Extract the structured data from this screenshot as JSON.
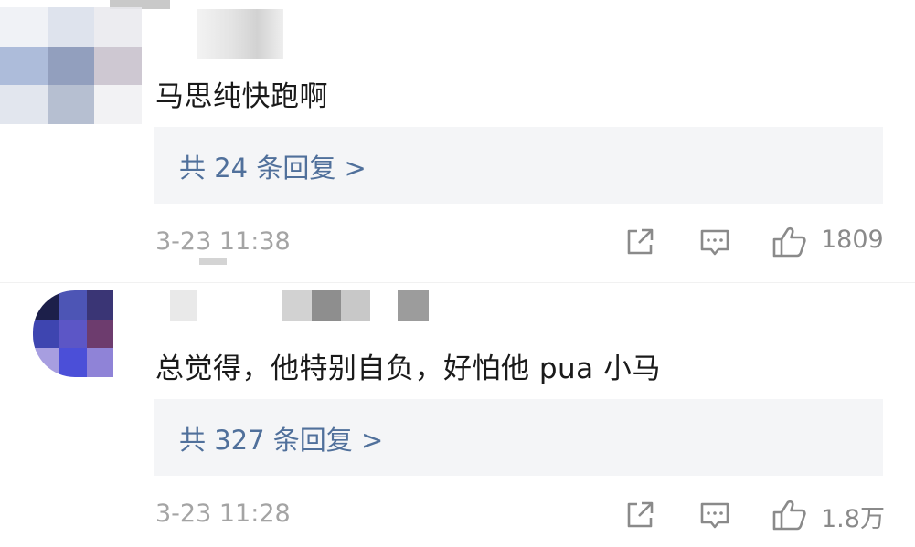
{
  "comments": [
    {
      "text": "马思纯快跑啊",
      "replies_label": "共 24 条回复 >",
      "timestamp": "3-23 11:38",
      "like_count": "1809",
      "avatar_colors": [
        "#dfe3ec",
        "#c9d2e2",
        "#e8ecf3",
        "#9fb1d4",
        "#7c8fb8",
        "#b7c2d9",
        "#c4c9d6",
        "#8e9bb8",
        "#d7dbe5"
      ]
    },
    {
      "text": "总觉得，他特别自负，好怕他 pua 小马",
      "replies_label": "共 327 条回复 >",
      "timestamp": "3-23 11:28",
      "like_count": "1.8万",
      "avatar_colors": [
        "#3a3f8c",
        "#5d4f9e",
        "#c9c6e2",
        "#4b52c4",
        "#6a5fc9",
        "#a8a3d6",
        "#b3aee0",
        "#7d74cf",
        "#e3e1f2"
      ]
    }
  ],
  "icons": {
    "share": "share-icon",
    "comment": "comment-icon",
    "like": "thumbs-up-icon"
  },
  "colors": {
    "reply_link": "#50709b",
    "reply_bg": "#f4f5f7",
    "meta_gray": "#a4a4a4"
  }
}
